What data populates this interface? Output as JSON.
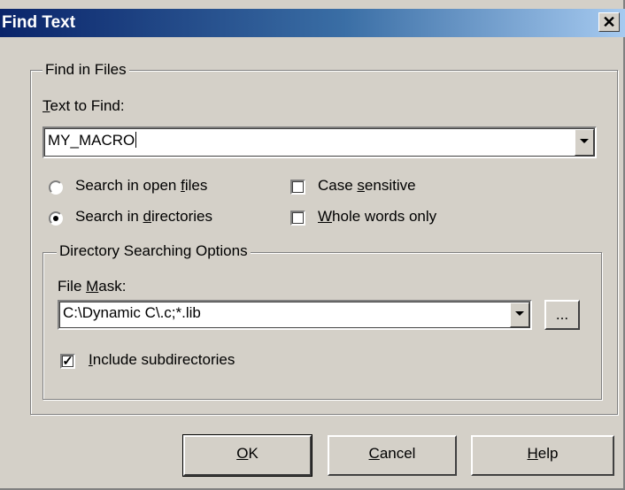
{
  "window": {
    "title": "Find Text",
    "close_glyph": "✕"
  },
  "find_group": {
    "legend": "Find in Files",
    "text_label": {
      "accel": "T",
      "rest": "ext to Find:"
    },
    "text_value": "MY_MACRO"
  },
  "options": {
    "radio_open": {
      "pre": "Search in open ",
      "accel": "f",
      "post": "iles",
      "selected": false
    },
    "radio_dirs": {
      "pre": "Search in ",
      "accel": "d",
      "post": "irectories",
      "selected": true
    },
    "case": {
      "pre": "Case ",
      "accel": "s",
      "post": "ensitive",
      "checked": false
    },
    "whole": {
      "pre": "",
      "accel": "W",
      "post": "hole words only",
      "checked": false
    }
  },
  "dir_group": {
    "legend": "Directory Searching Options",
    "mask_label": {
      "pre": "File ",
      "accel": "M",
      "post": "ask:"
    },
    "mask_value": "C:\\Dynamic C\\.c;*.lib",
    "browse_label": "...",
    "subdirs": {
      "accel": "I",
      "post": "nclude subdirectories",
      "checked": true,
      "mark": "✓"
    }
  },
  "buttons": {
    "ok": {
      "accel": "O",
      "post": "K"
    },
    "cancel": {
      "accel": "C",
      "post": "ancel"
    },
    "help": {
      "accel": "H",
      "post": "elp"
    }
  },
  "colors": {
    "title_start": "#0a246a",
    "title_end": "#a6caf0",
    "face": "#d4d0c8"
  }
}
